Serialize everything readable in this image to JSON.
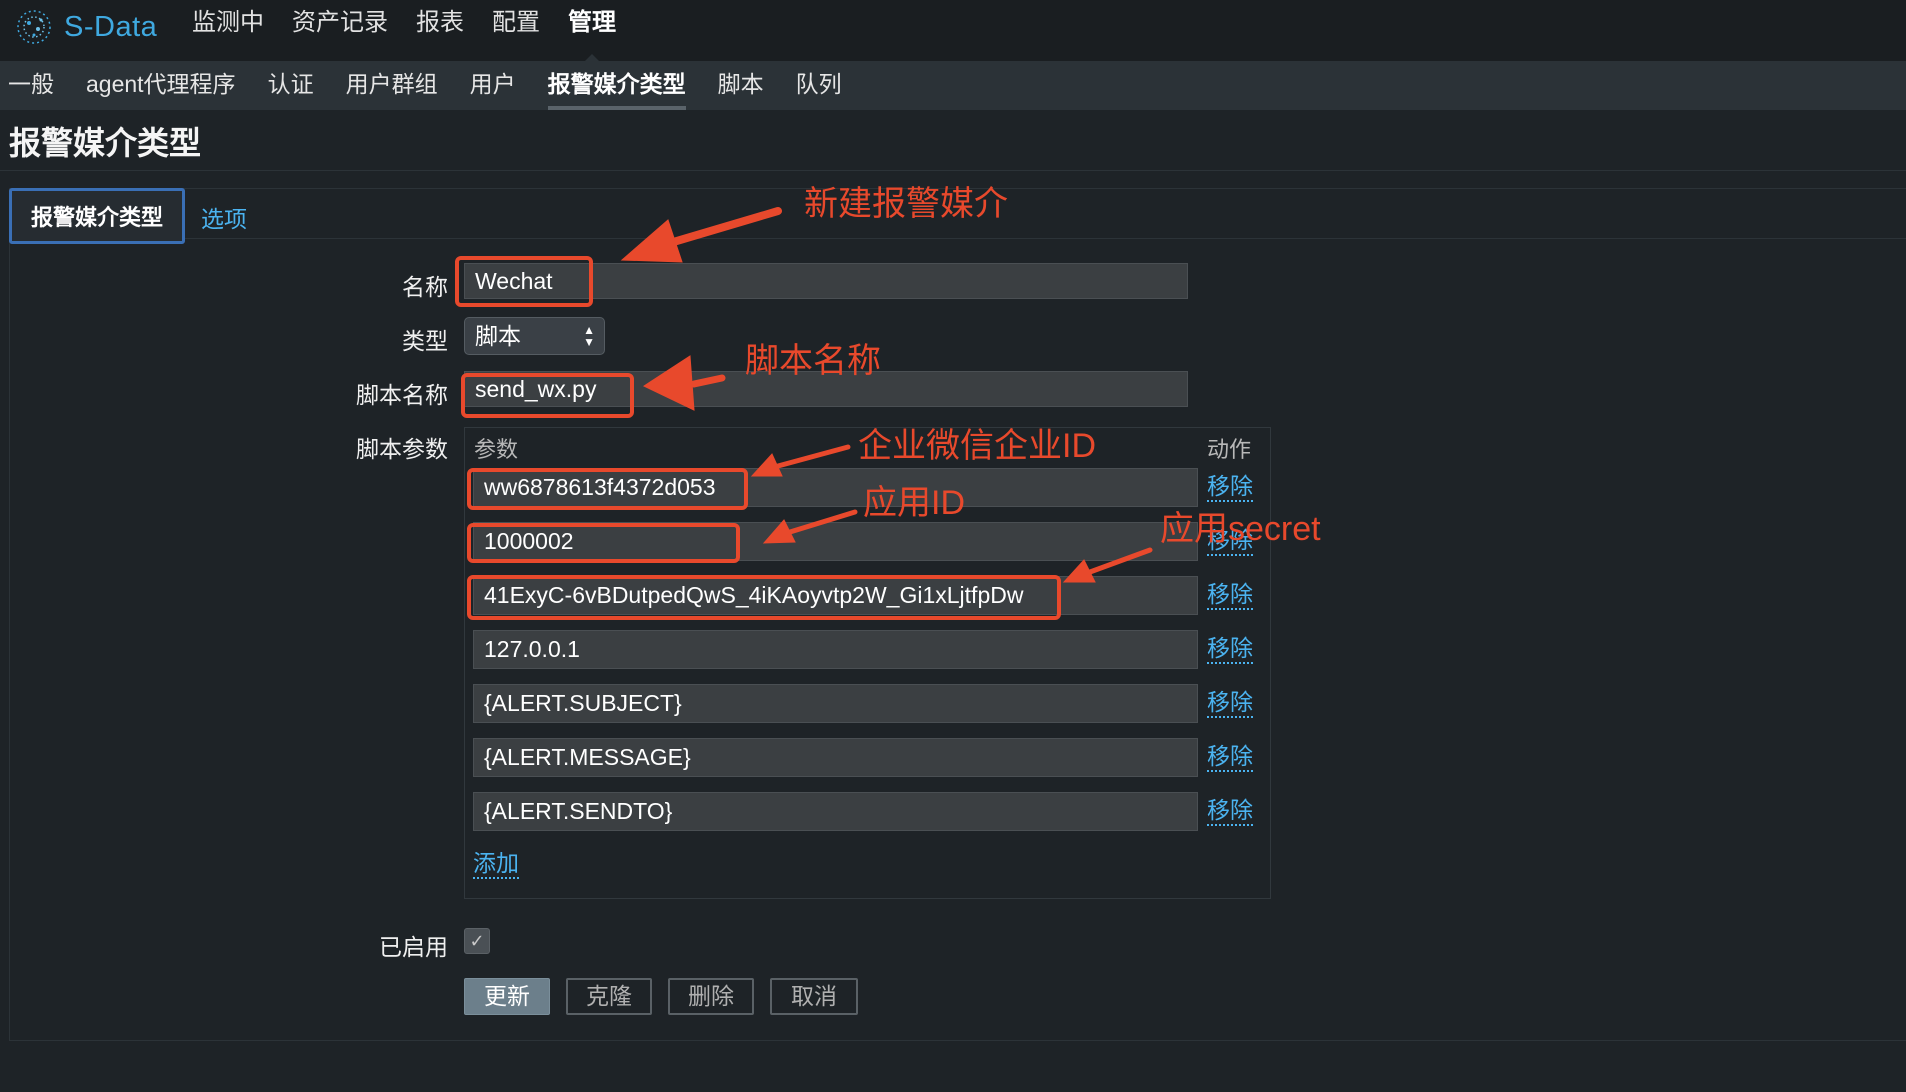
{
  "app": {
    "logo_text": "S-Data"
  },
  "main_nav": [
    {
      "label": "监测中"
    },
    {
      "label": "资产记录"
    },
    {
      "label": "报表"
    },
    {
      "label": "配置"
    },
    {
      "label": "管理",
      "active": true
    }
  ],
  "sub_nav": [
    {
      "label": "一般"
    },
    {
      "label": "agent代理程序"
    },
    {
      "label": "认证"
    },
    {
      "label": "用户群组"
    },
    {
      "label": "用户"
    },
    {
      "label": "报警媒介类型",
      "active": true
    },
    {
      "label": "脚本"
    },
    {
      "label": "队列"
    }
  ],
  "page": {
    "title": "报警媒介类型"
  },
  "tabs": {
    "active": "报警媒介类型",
    "other": "选项"
  },
  "form": {
    "name_label": "名称",
    "name_value": "Wechat",
    "type_label": "类型",
    "type_value": "脚本",
    "script_name_label": "脚本名称",
    "script_name_value": "send_wx.py",
    "script_params_label": "脚本参数",
    "params_header": "参数",
    "action_header": "动作",
    "remove_label": "移除",
    "params": [
      "ww6878613f4372d053",
      "1000002",
      "41ExyC-6vBDutpedQwS_4iKAoyvtp2W_Gi1xLjtfpDw",
      "127.0.0.1",
      "{ALERT.SUBJECT}",
      "{ALERT.MESSAGE}",
      "{ALERT.SENDTO}"
    ],
    "add_label": "添加",
    "enabled_label": "已启用",
    "enabled": true
  },
  "buttons": {
    "update": "更新",
    "clone": "克隆",
    "delete": "删除",
    "cancel": "取消"
  },
  "annotations": {
    "new_media": "新建报警媒介",
    "script_name": "脚本名称",
    "corp_id": "企业微信企业ID",
    "app_id": "应用ID",
    "app_secret": "应用secret"
  },
  "colors": {
    "accent": "#4bb3f0",
    "annotation": "#e8492c",
    "logo": "#3fa9e0"
  }
}
